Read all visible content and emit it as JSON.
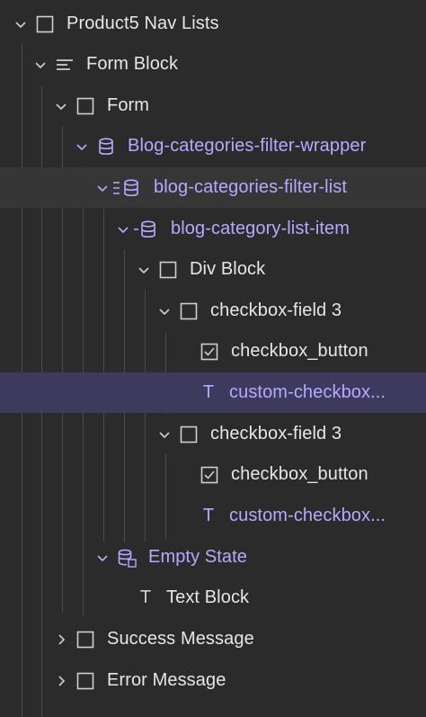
{
  "colors": {
    "purple": "#b9a8ff",
    "text": "#e6e6e6",
    "bg": "#2b2b2b",
    "selected": "#3e3a5e"
  },
  "nodes": [
    {
      "label": "Product5 Nav Lists",
      "icon": "box-icon",
      "chevron": "down"
    },
    {
      "label": "Form Block",
      "icon": "form-block-icon",
      "chevron": "down"
    },
    {
      "label": "Form",
      "icon": "box-icon",
      "chevron": "down"
    },
    {
      "label": "Blog-categories-filter-wrapper",
      "icon": "database-icon",
      "chevron": "down"
    },
    {
      "label": "blog-categories-filter-list",
      "icon": "collection-list-icon",
      "chevron": "down"
    },
    {
      "label": "blog-category-list-item",
      "icon": "collection-item-icon",
      "chevron": "down"
    },
    {
      "label": "Div Block",
      "icon": "box-icon",
      "chevron": "down"
    },
    {
      "label": "checkbox-field 3",
      "icon": "box-icon",
      "chevron": "down"
    },
    {
      "label": "checkbox_button",
      "icon": "checkbox-icon",
      "chevron": ""
    },
    {
      "label": "custom-checkbox...",
      "icon": "text-icon",
      "glyph": "T",
      "chevron": ""
    },
    {
      "label": "checkbox-field 3",
      "icon": "box-icon",
      "chevron": "down"
    },
    {
      "label": "checkbox_button",
      "icon": "checkbox-icon",
      "chevron": ""
    },
    {
      "label": "custom-checkbox...",
      "icon": "text-icon",
      "glyph": "T",
      "chevron": ""
    },
    {
      "label": "Empty State",
      "icon": "empty-state-icon",
      "chevron": "down"
    },
    {
      "label": "Text Block",
      "icon": "text-icon",
      "glyph": "T",
      "chevron": ""
    },
    {
      "label": "Success Message",
      "icon": "box-icon",
      "chevron": "right"
    },
    {
      "label": "Error Message",
      "icon": "box-icon",
      "chevron": "right"
    }
  ]
}
